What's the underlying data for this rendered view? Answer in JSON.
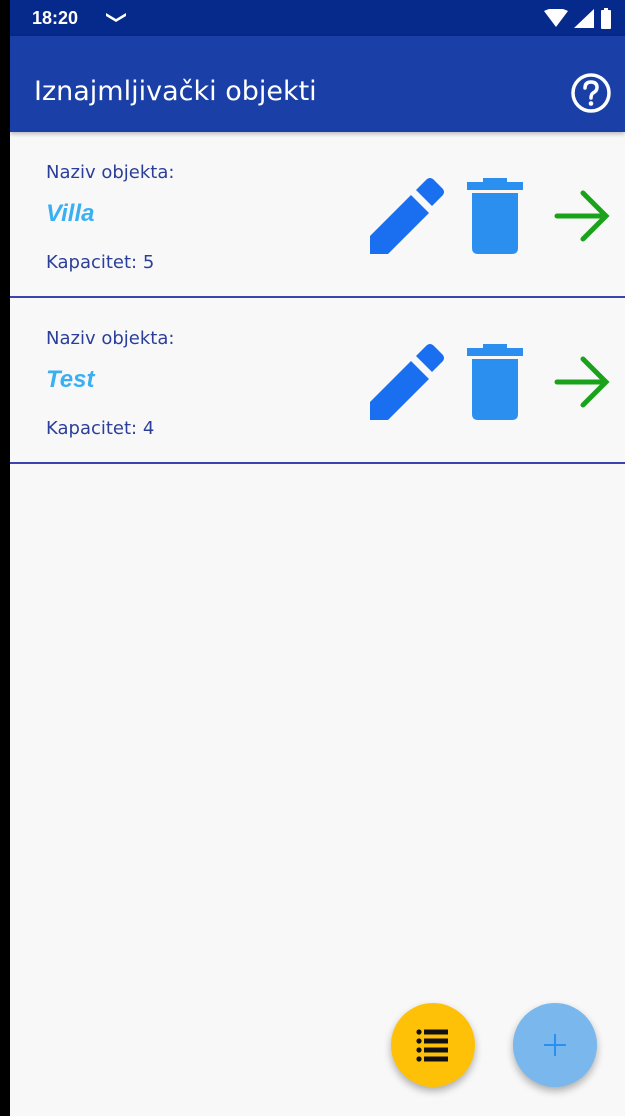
{
  "status_bar": {
    "time": "18:20",
    "icons": [
      "notification-icon",
      "wifi-icon",
      "signal-icon",
      "battery-icon"
    ],
    "background": "#062a8c"
  },
  "app_bar": {
    "title": "Iznajmljivački objekti",
    "help_icon": "help-circle-icon",
    "background": "#1a3fa6"
  },
  "objects": [
    {
      "label": "Naziv objekta:",
      "name": "Villa",
      "capacity": "Kapacitet: 5"
    },
    {
      "label": "Naziv objekta:",
      "name": "Test",
      "capacity": "Kapacitet: 4"
    }
  ],
  "actions": {
    "edit_icon": "pencil-icon",
    "delete_icon": "trash-icon",
    "open_icon": "arrow-right-icon"
  },
  "fabs": {
    "list_icon": "list-icon",
    "add_icon": "plus-icon"
  },
  "colors": {
    "label_text": "#2b3f9a",
    "name_text": "#3ab0f2",
    "edit_icon": "#1a6ef0",
    "delete_icon": "#2b8ff0",
    "open_icon": "#1aa31a",
    "divider": "#3b44b0",
    "fab_list": "#ffc107",
    "fab_add": "#79b7ec"
  }
}
